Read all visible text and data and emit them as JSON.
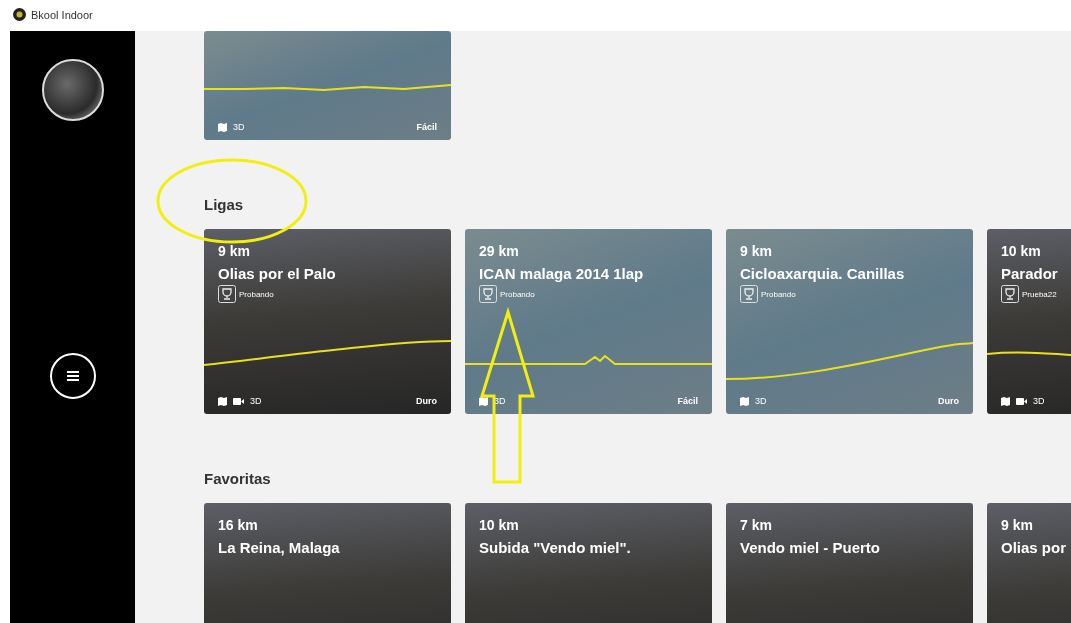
{
  "window": {
    "title": "Bkool Indoor"
  },
  "sections": [
    {
      "cards": [
        {
          "kind": "map",
          "video": false,
          "mode": "3D",
          "difficulty": "Fácil"
        }
      ]
    },
    {
      "title": "Ligas",
      "cards": [
        {
          "kind": "photo",
          "distance": "9 km",
          "name": "Olias por el Palo",
          "league": "Probando",
          "video": true,
          "mode": "3D",
          "difficulty": "Duro"
        },
        {
          "kind": "map",
          "distance": "29 km",
          "name": "ICAN malaga 2014 1lap",
          "league": "Probando",
          "video": false,
          "mode": "3D",
          "difficulty": "Fácil"
        },
        {
          "kind": "map",
          "distance": "9 km",
          "name": "Cicloaxarquia. Canillas",
          "league": "Probando",
          "video": false,
          "mode": "3D",
          "difficulty": "Duro"
        },
        {
          "kind": "photo",
          "distance": "10 km",
          "name": "Parador",
          "league": "Prueba22",
          "video": true,
          "mode": "3D"
        }
      ]
    },
    {
      "title": "Favoritas",
      "cards": [
        {
          "kind": "photo",
          "distance": "16 km",
          "name": "La Reina, Malaga"
        },
        {
          "kind": "photo",
          "distance": "10 km",
          "name": "Subida \"Vendo miel\"."
        },
        {
          "kind": "photo",
          "distance": "7 km",
          "name": "Vendo miel - Puerto"
        },
        {
          "kind": "photo",
          "distance": "9 km",
          "name": "Olias por"
        }
      ]
    }
  ]
}
